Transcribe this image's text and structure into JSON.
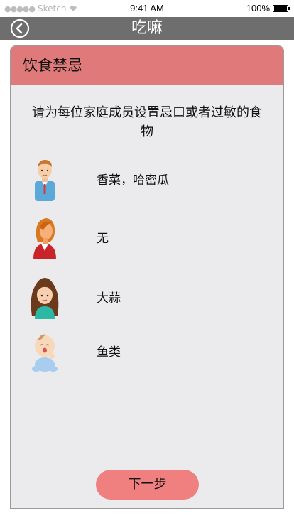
{
  "status_bar": {
    "carrier": "Sketch",
    "signal_dots": "●●●●●",
    "time": "9:41 AM",
    "battery_percent": "100%",
    "battery_level": 1.0
  },
  "nav": {
    "title": "吃嘛",
    "back_icon": "back-arrow-circle-icon"
  },
  "card": {
    "header": "饮食禁忌",
    "instruction": "请为每位家庭成员设置忌口或者过敏的食物",
    "header_color": "#e07a7a"
  },
  "members": [
    {
      "avatar": "man-avatar-icon",
      "allergy": "香菜，哈密瓜"
    },
    {
      "avatar": "woman-avatar-icon",
      "allergy": "无"
    },
    {
      "avatar": "girl-avatar-icon",
      "allergy": "大蒜"
    },
    {
      "avatar": "baby-avatar-icon",
      "allergy": "鱼类"
    }
  ],
  "next_button": {
    "label": "下一步",
    "color": "#f07f7f"
  }
}
